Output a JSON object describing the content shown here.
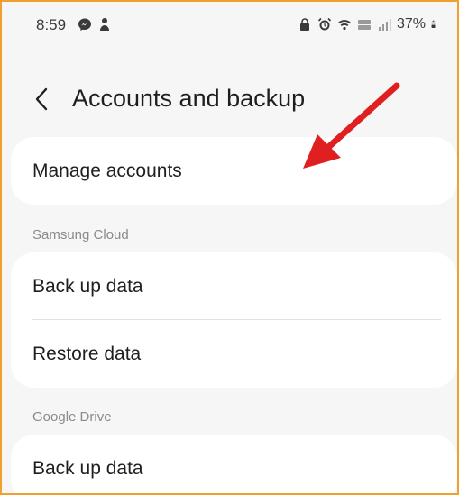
{
  "status_bar": {
    "time": "8:59",
    "battery": "37%",
    "left_icons": [
      "messenger-icon",
      "notification-icon"
    ],
    "right_icons": [
      "lock-icon",
      "alarm-icon",
      "wifi-icon",
      "volte-icon",
      "signal-icon",
      "battery-icon"
    ]
  },
  "header": {
    "back_icon": "chevron-left-icon",
    "title": "Accounts and backup"
  },
  "items": {
    "manage_accounts": "Manage accounts"
  },
  "sections": {
    "samsung_cloud": {
      "label": "Samsung Cloud",
      "items": [
        "Back up data",
        "Restore data"
      ]
    },
    "google_drive": {
      "label": "Google Drive",
      "items": [
        "Back up data"
      ]
    }
  },
  "colors": {
    "frame_border": "#f0a030",
    "annotation_arrow": "#e02020",
    "background": "#f6f6f6",
    "card": "#ffffff"
  }
}
